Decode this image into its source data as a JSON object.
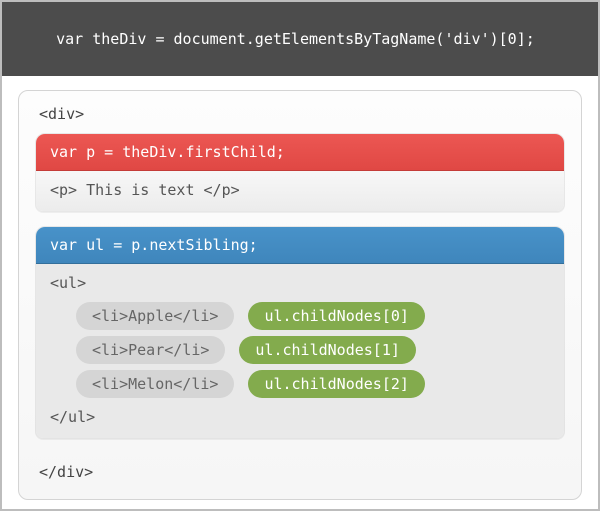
{
  "topbar": {
    "code": "var theDiv = document.getElementsByTagName('div')[0];"
  },
  "div": {
    "open": "<div>",
    "close": "</div>",
    "p_block": {
      "header": "var p = theDiv.firstChild;",
      "body": "<p> This is text </p>"
    },
    "ul_block": {
      "header": "var ul = p.nextSibling;",
      "open": "<ul>",
      "close": "</ul>",
      "items": [
        {
          "li": "<li>Apple</li>",
          "ref": "ul.childNodes[0]"
        },
        {
          "li": "<li>Pear</li>",
          "ref": "ul.childNodes[1]"
        },
        {
          "li": "<li>Melon</li>",
          "ref": "ul.childNodes[2]"
        }
      ]
    }
  }
}
